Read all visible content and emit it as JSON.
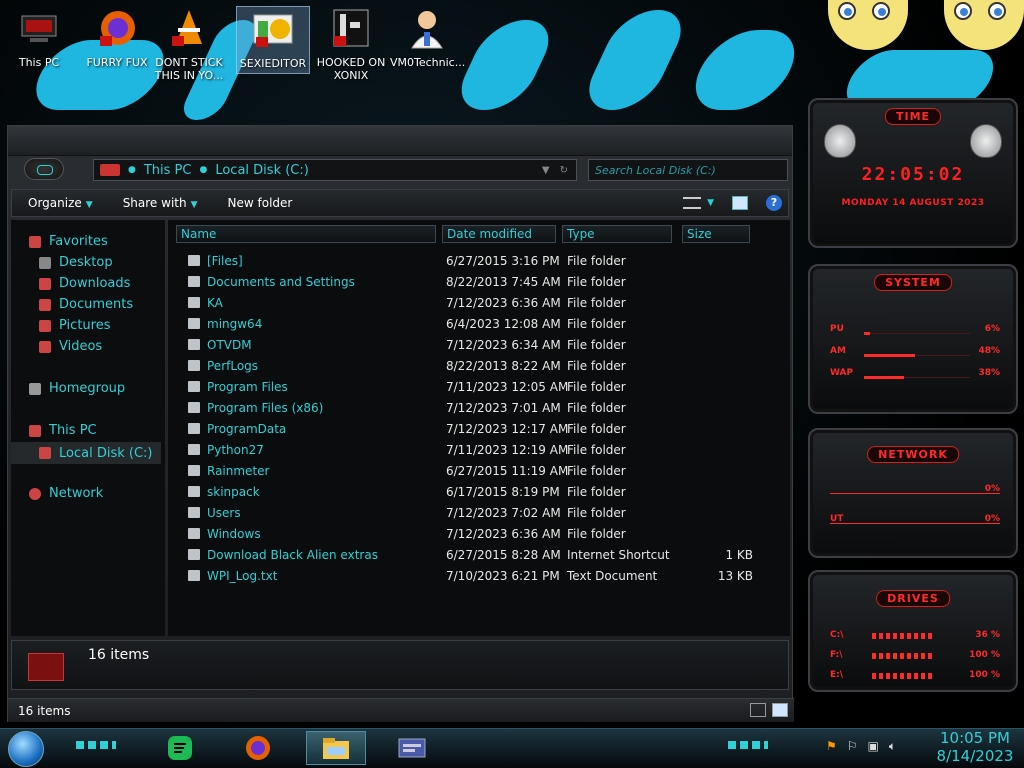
{
  "desktop": {
    "icons": [
      {
        "label": "This PC"
      },
      {
        "label": "FURRY FUX"
      },
      {
        "label": "DONT STICK THIS IN YO..."
      },
      {
        "label": "SEXIEDITOR"
      },
      {
        "label": "HOOKED ON XONIX"
      },
      {
        "label": "VM0Technic..."
      }
    ]
  },
  "explorer": {
    "address": {
      "crumbs": [
        "This PC",
        "Local Disk (C:)"
      ]
    },
    "search": {
      "placeholder": "Search Local Disk (C:)"
    },
    "toolbar": {
      "organize": "Organize",
      "share_with": "Share with",
      "new_folder": "New folder"
    },
    "nav": {
      "favorites": "Favorites",
      "desktop": "Desktop",
      "downloads": "Downloads",
      "documents": "Documents",
      "pictures": "Pictures",
      "videos": "Videos",
      "homegroup": "Homegroup",
      "this_pc": "This PC",
      "local_disk": "Local Disk (C:)",
      "network": "Network"
    },
    "columns": {
      "name": "Name",
      "date": "Date modified",
      "type": "Type",
      "size": "Size"
    },
    "files": [
      {
        "name": "[Files]",
        "date": "6/27/2015 3:16 PM",
        "type": "File folder",
        "size": ""
      },
      {
        "name": "Documents and Settings",
        "date": "8/22/2013 7:45 AM",
        "type": "File folder",
        "size": ""
      },
      {
        "name": "KA",
        "date": "7/12/2023 6:36 AM",
        "type": "File folder",
        "size": ""
      },
      {
        "name": "mingw64",
        "date": "6/4/2023 12:08 AM",
        "type": "File folder",
        "size": ""
      },
      {
        "name": "OTVDM",
        "date": "7/12/2023 6:34 AM",
        "type": "File folder",
        "size": ""
      },
      {
        "name": "PerfLogs",
        "date": "8/22/2013 8:22 AM",
        "type": "File folder",
        "size": ""
      },
      {
        "name": "Program Files",
        "date": "7/11/2023 12:05 AM",
        "type": "File folder",
        "size": ""
      },
      {
        "name": "Program Files (x86)",
        "date": "7/12/2023 7:01 AM",
        "type": "File folder",
        "size": ""
      },
      {
        "name": "ProgramData",
        "date": "7/12/2023 12:17 AM",
        "type": "File folder",
        "size": ""
      },
      {
        "name": "Python27",
        "date": "7/11/2023 12:19 AM",
        "type": "File folder",
        "size": ""
      },
      {
        "name": "Rainmeter",
        "date": "6/27/2015 11:19 AM",
        "type": "File folder",
        "size": ""
      },
      {
        "name": "skinpack",
        "date": "6/17/2015 8:19 PM",
        "type": "File folder",
        "size": ""
      },
      {
        "name": "Users",
        "date": "7/12/2023 7:02 AM",
        "type": "File folder",
        "size": ""
      },
      {
        "name": "Windows",
        "date": "7/12/2023 6:36 AM",
        "type": "File folder",
        "size": ""
      },
      {
        "name": "Download Black Alien extras",
        "date": "6/27/2015 8:28 AM",
        "type": "Internet Shortcut",
        "size": "1 KB"
      },
      {
        "name": "WPI_Log.txt",
        "date": "7/10/2023 6:21 PM",
        "type": "Text Document",
        "size": "13 KB"
      }
    ],
    "details_count": "16 items",
    "status_count": "16 items"
  },
  "gadgets": {
    "time": {
      "title": "TIME",
      "clock": "22:05:02",
      "date": "MONDAY 14 AUGUST 2023"
    },
    "system": {
      "title": "SYSTEM",
      "rows": [
        {
          "label": "PU",
          "value": "6%",
          "level": 0.06
        },
        {
          "label": "AM",
          "value": "48%",
          "level": 0.48
        },
        {
          "label": "WAP",
          "value": "38%",
          "level": 0.38
        }
      ]
    },
    "network": {
      "title": "NETWORK",
      "rows": [
        {
          "label": "",
          "value": "0%"
        },
        {
          "label": "UT",
          "value": "0%"
        }
      ]
    },
    "drives": {
      "title": "DRIVES",
      "rows": [
        {
          "label": "C:\\",
          "value": "36 %"
        },
        {
          "label": "F:\\",
          "value": "100 %"
        },
        {
          "label": "E:\\",
          "value": "100 %"
        }
      ]
    }
  },
  "taskbar": {
    "apps": [
      "spotify-app",
      "firefox-app",
      "file-explorer-app",
      "other-app"
    ],
    "clock_time": "10:05 PM",
    "clock_date": "8/14/2023"
  },
  "colors": {
    "accent": "#2fd0d6",
    "alert": "#ff2a2a",
    "window_bg": "#0b0c0d"
  }
}
